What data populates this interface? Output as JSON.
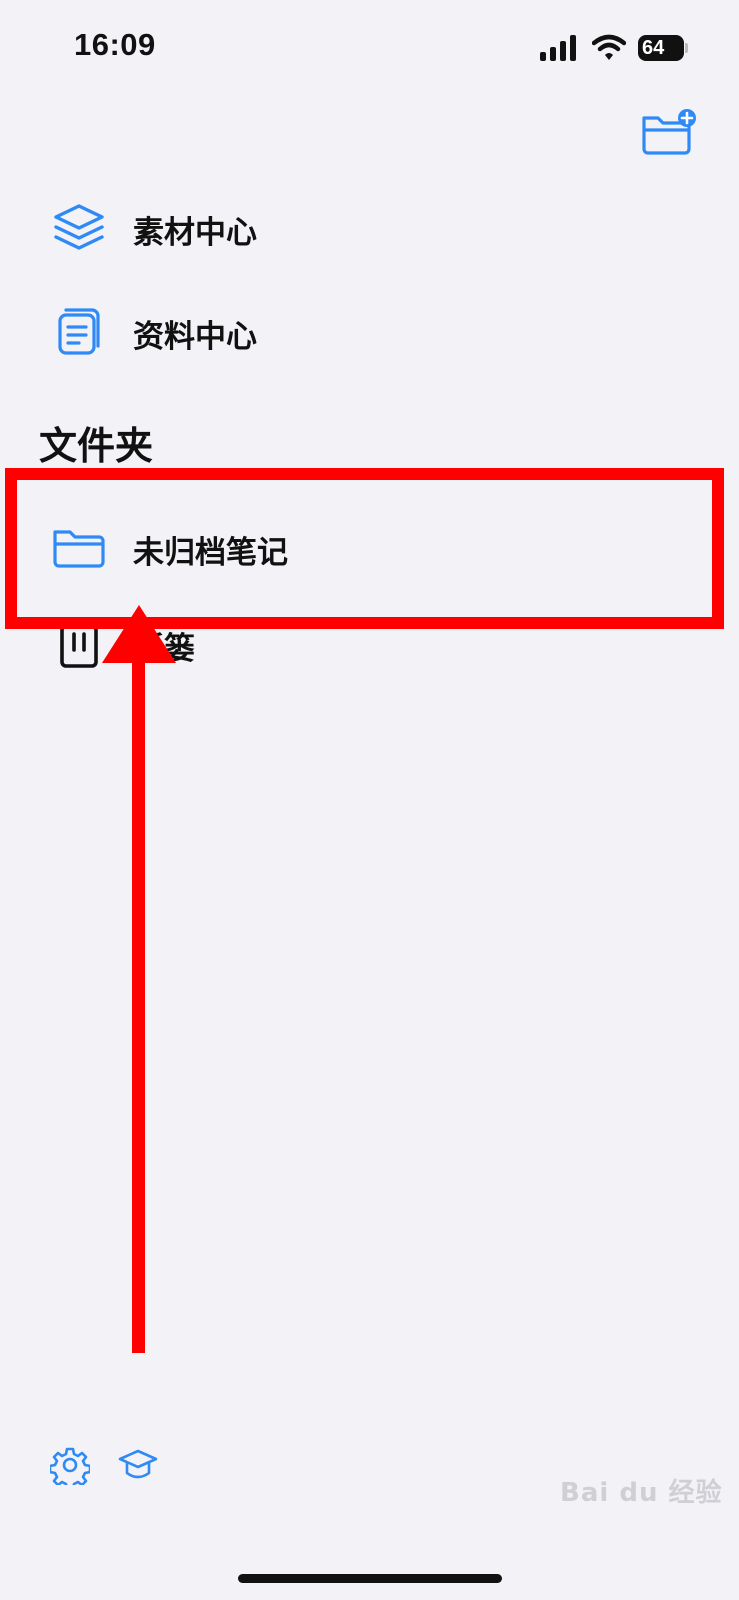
{
  "status_bar": {
    "time": "16:09",
    "battery": "64"
  },
  "nav": {
    "items": [
      {
        "label": "素材中心",
        "icon": "layers-icon"
      },
      {
        "label": "资料中心",
        "icon": "document-icon"
      }
    ]
  },
  "folders": {
    "heading": "文件夹",
    "items": [
      {
        "label": "未归档笔记",
        "icon": "folder-icon"
      },
      {
        "label": "纸篓",
        "icon": "trash-icon"
      }
    ]
  },
  "bottom_bar": {
    "icons": [
      "gear-icon",
      "graduation-cap-icon"
    ]
  },
  "watermark": "Bai du 经验",
  "colors": {
    "accent": "#2f8af5",
    "annotation": "#ff0000",
    "background": "#f2f2f7"
  }
}
